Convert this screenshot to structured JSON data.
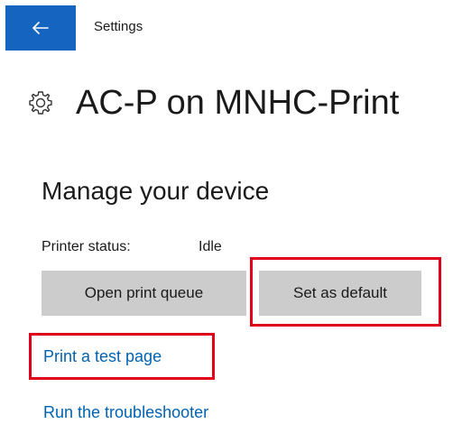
{
  "window": {
    "title": "Settings"
  },
  "header": {
    "title": "AC-P on MNHC-Print",
    "icon": "gear-icon"
  },
  "section": {
    "title": "Manage your device",
    "status_label": "Printer status:",
    "status_value": "Idle"
  },
  "buttons": {
    "open_queue": "Open print queue",
    "set_default": "Set as default"
  },
  "links": {
    "print_test_page": "Print a test page",
    "run_troubleshooter": "Run the troubleshooter"
  },
  "colors": {
    "accent": "#1565c0",
    "link": "#0063b1",
    "button_bg": "#cccccc",
    "highlight": "#e0001b"
  }
}
